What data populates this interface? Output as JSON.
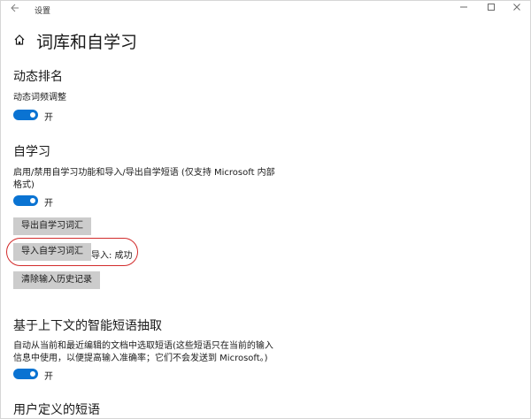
{
  "window": {
    "title": "设置",
    "back_icon": "back-arrow-icon",
    "minimize_icon": "minimize-icon",
    "maximize_icon": "maximize-icon",
    "close_icon": "close-icon"
  },
  "page": {
    "title": "词库和自学习",
    "icon": "home-icon"
  },
  "dynamic_ranking": {
    "heading": "动态排名",
    "setting_label": "动态词频调整",
    "toggle_state": "开"
  },
  "self_learning": {
    "heading": "自学习",
    "description_line1": "启用/禁用自学习功能和导入/导出自学短语 (仅支持 Microsoft 内部",
    "description_line2": "格式)",
    "toggle_state": "开",
    "export_button": "导出自学习词汇",
    "import_button": "导入自学习词汇",
    "import_status": "导入: 成功",
    "clear_button": "清除输入历史记录"
  },
  "context_phrases": {
    "heading": "基于上下文的智能短语抽取",
    "description_line1": "自动从当前和最近编辑的文档中选取短语(这些短语只在当前的输入",
    "description_line2": "信息中使用，以便提高输入准确率；它们不会发送到 Microsoft。)",
    "toggle_state": "开"
  },
  "user_phrases": {
    "heading": "用户定义的短语"
  },
  "colors": {
    "accent": "#0a73d2",
    "button_bg": "#cccccc",
    "highlight": "#d22b2b"
  }
}
